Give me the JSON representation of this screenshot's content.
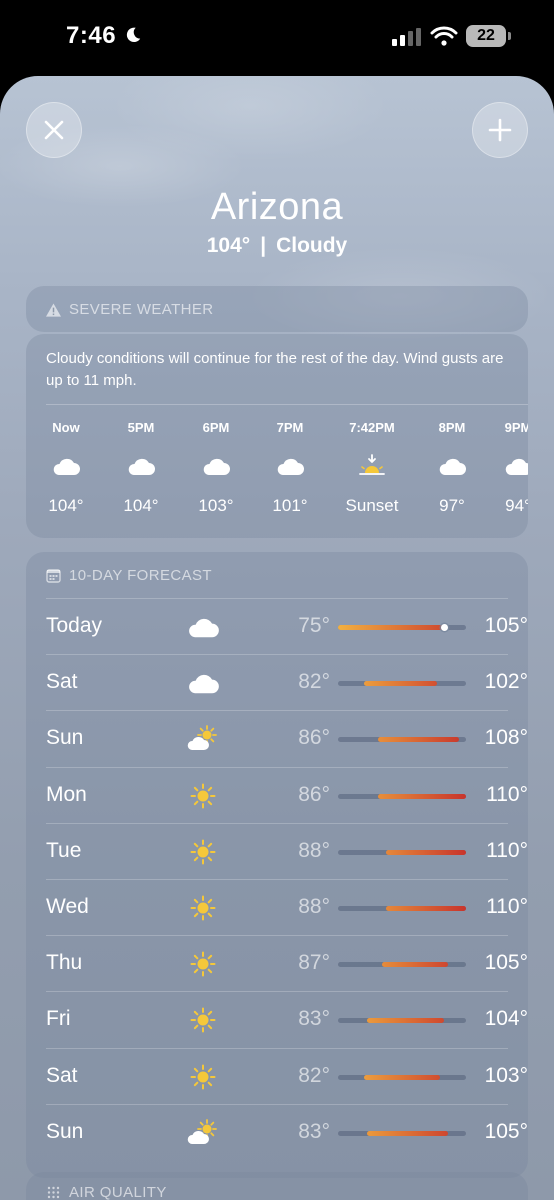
{
  "status_bar": {
    "time": "7:46",
    "battery": "22"
  },
  "header": {
    "city": "Arizona",
    "temperature": "104°",
    "separator": "|",
    "condition": "Cloudy"
  },
  "severe_weather": {
    "title": "SEVERE WEATHER",
    "description": "Cloudy conditions will continue for the rest of the day. Wind gusts are up to 11 mph."
  },
  "hourly": [
    {
      "label": "Now",
      "icon": "cloud-icon",
      "temp": "104°"
    },
    {
      "label": "5PM",
      "icon": "cloud-icon",
      "temp": "104°"
    },
    {
      "label": "6PM",
      "icon": "cloud-icon",
      "temp": "103°"
    },
    {
      "label": "7PM",
      "icon": "cloud-icon",
      "temp": "101°"
    },
    {
      "label": "7:42PM",
      "icon": "sunset-icon",
      "temp": "Sunset"
    },
    {
      "label": "8PM",
      "icon": "cloud-icon",
      "temp": "97°"
    },
    {
      "label": "9PM",
      "icon": "cloud-icon",
      "temp": "94°"
    }
  ],
  "forecast": {
    "title": "10-DAY FORECAST",
    "range_min": 75,
    "range_max": 110,
    "days": [
      {
        "day": "Today",
        "icon": "cloud-icon",
        "low": "75°",
        "high": "105°",
        "low_val": 75,
        "high_val": 105,
        "current": 104
      },
      {
        "day": "Sat",
        "icon": "cloud-icon",
        "low": "82°",
        "high": "102°",
        "low_val": 82,
        "high_val": 102
      },
      {
        "day": "Sun",
        "icon": "partly-cloudy-icon",
        "low": "86°",
        "high": "108°",
        "low_val": 86,
        "high_val": 108
      },
      {
        "day": "Mon",
        "icon": "sun-icon",
        "low": "86°",
        "high": "110°",
        "low_val": 86,
        "high_val": 110
      },
      {
        "day": "Tue",
        "icon": "sun-icon",
        "low": "88°",
        "high": "110°",
        "low_val": 88,
        "high_val": 110
      },
      {
        "day": "Wed",
        "icon": "sun-icon",
        "low": "88°",
        "high": "110°",
        "low_val": 88,
        "high_val": 110
      },
      {
        "day": "Thu",
        "icon": "sun-icon",
        "low": "87°",
        "high": "105°",
        "low_val": 87,
        "high_val": 105
      },
      {
        "day": "Fri",
        "icon": "sun-icon",
        "low": "83°",
        "high": "104°",
        "low_val": 83,
        "high_val": 104
      },
      {
        "day": "Sat",
        "icon": "sun-icon",
        "low": "82°",
        "high": "103°",
        "low_val": 82,
        "high_val": 103
      },
      {
        "day": "Sun",
        "icon": "partly-cloudy-icon",
        "low": "83°",
        "high": "105°",
        "low_val": 83,
        "high_val": 105
      }
    ]
  },
  "air_quality": {
    "title": "AIR QUALITY"
  },
  "colors": {
    "sun": "#f5c83a",
    "cool_bar": "#f2b040",
    "hot_bar": "#c8342c"
  }
}
